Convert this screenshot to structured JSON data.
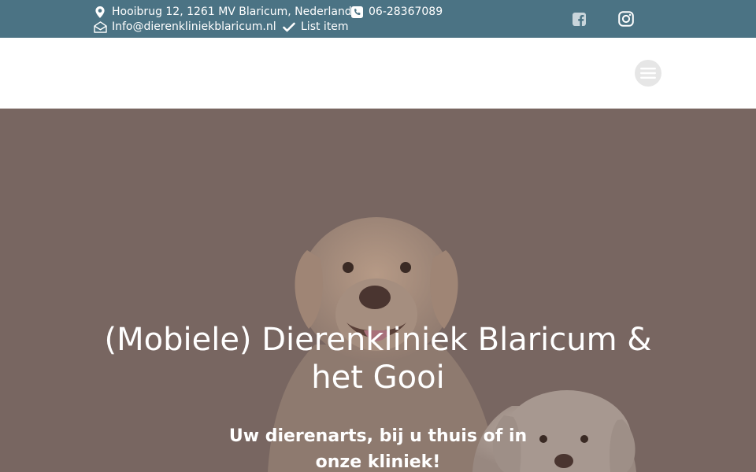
{
  "topbar": {
    "address": "Hooibrug 12, 1261 MV Blaricum, Nederland",
    "phone": "06-28367089",
    "email": "Info@dierenkliniekblaricum.nl",
    "list_item": "List item",
    "social": [
      "facebook-icon",
      "instagram-icon"
    ],
    "background_color": "#4b7384"
  },
  "header": {
    "menu_icon": "hamburger-menu-icon"
  },
  "hero": {
    "title": "(Mobiele) Dierenkliniek Blaricum & het Gooi",
    "subtitle": "Uw dierenarts, bij u thuis of in onze kliniek!",
    "image": "labrador and small white dog photo",
    "overlay_color": "#786661"
  }
}
